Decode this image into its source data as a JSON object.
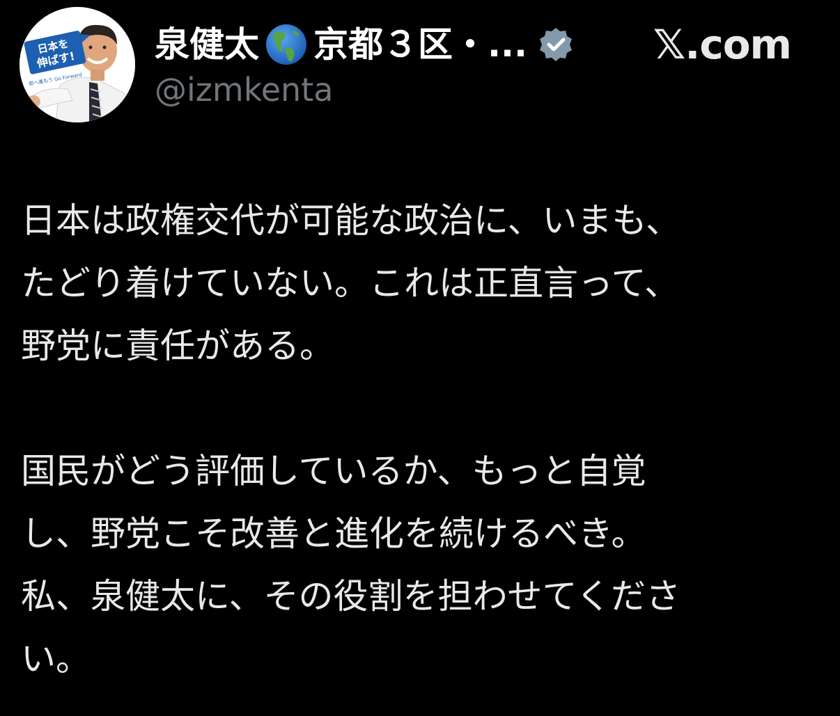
{
  "tweet": {
    "author": {
      "display_name": "泉健太",
      "display_name_tail": "京都３区・...",
      "name_emoji": "globe-americas-icon",
      "verified": true,
      "verified_color": "#829aab",
      "handle": "@izmkenta",
      "avatar": {
        "banner_text": "日本を伸ばす!",
        "sub_text": "前へ進もう Go Forward"
      }
    },
    "site_badge": "𝕏.com",
    "paragraphs": [
      {
        "lines": [
          "日本は政権交代が可能な政治に、いまも、",
          "たどり着けていない。これは正直言って、",
          "野党に責任がある。"
        ]
      },
      {
        "lines": [
          "国民がどう評価しているか、もっと自覚",
          "し、野党こそ改善と進化を続けるべき。",
          "私、泉健太に、その役割を担わせてくださ",
          "い。"
        ]
      }
    ]
  },
  "colors": {
    "background": "#000000",
    "text": "#e7e9ea",
    "handle": "#71767b",
    "avatar_banner": "#1d5fb0"
  }
}
